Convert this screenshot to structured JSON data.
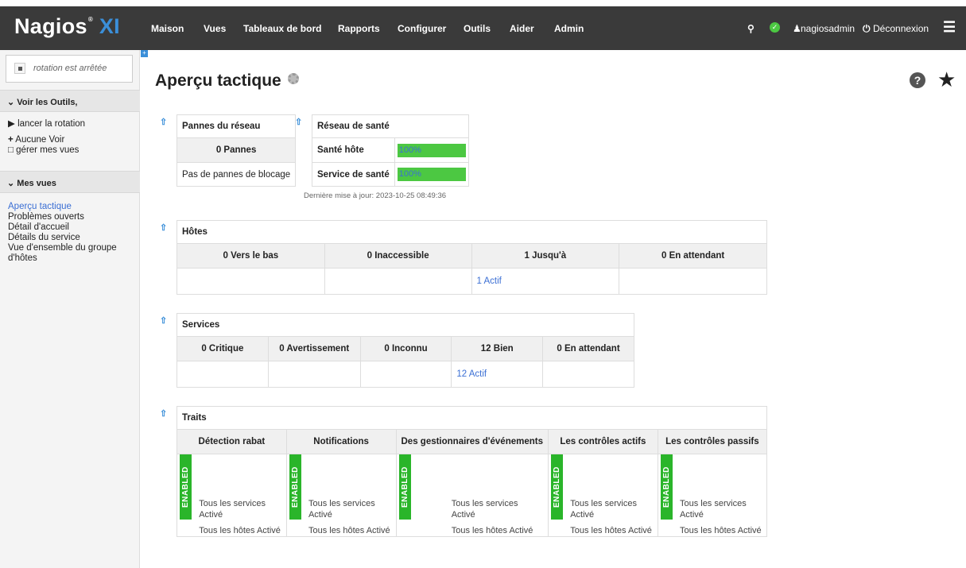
{
  "app": {
    "logo_main": "Nagios",
    "logo_xi": "XI",
    "logo_mark": "®"
  },
  "topnav": {
    "items": [
      "Maison",
      "Vues",
      "Tableaux de bord",
      "Rapports",
      "Configurer",
      "Outils",
      "Aider",
      "Admin"
    ],
    "user": "nagiosadmin",
    "logout": "Déconnexion"
  },
  "sidebar": {
    "rotation_status": "rotation est arrêtée",
    "tools_header": "Voir les Outils,",
    "start_rotation": "lancer la rotation",
    "no_view": "Aucune Voir",
    "manage_views": "gérer mes vues",
    "my_views_header": "Mes vues",
    "views": [
      "Aperçu tactique",
      "Problèmes ouverts",
      "Détail d'accueil",
      "Détails du service",
      "Vue d'ensemble du groupe",
      "d'hôtes"
    ]
  },
  "page": {
    "title": "Aperçu tactique"
  },
  "network_outages": {
    "title": "Pannes du réseau",
    "count": "0 Pannes",
    "note": "Pas de pannes de blocage"
  },
  "network_health": {
    "title": "Réseau de santé",
    "host_label": "Santé hôte",
    "host_value": "100%",
    "host_percent": 100,
    "service_label": "Service de santé",
    "service_value": "100%",
    "service_percent": 100,
    "updated": "Dernière mise à jour: 2023-10-25 08:49:36"
  },
  "hosts": {
    "title": "Hôtes",
    "columns": [
      "0 Vers le bas",
      "0 Inaccessible",
      "1 Jusqu'à",
      "0 En attendant"
    ],
    "details": [
      "",
      "",
      "1 Actif",
      ""
    ]
  },
  "services": {
    "title": "Services",
    "columns": [
      "0 Critique",
      "0 Avertissement",
      "0 Inconnu",
      "12 Bien",
      "0 En attendant"
    ],
    "details": [
      "",
      "",
      "",
      "12 Actif",
      ""
    ]
  },
  "features": {
    "title": "Traits",
    "badge": "ENABLED",
    "columns": [
      "Détection rabat",
      "Notifications",
      "Des gestionnaires d'événements",
      "Les contrôles actifs",
      "Les contrôles passifs"
    ],
    "line1": "Tous les services",
    "line2": "Activé",
    "line3": "Tous les hôtes Activé"
  },
  "colors": {
    "topbar": "#3a3a3a",
    "accent": "#3b8fd9",
    "health_bar": "#4cc842",
    "enabled_badge": "#2ab52a"
  }
}
